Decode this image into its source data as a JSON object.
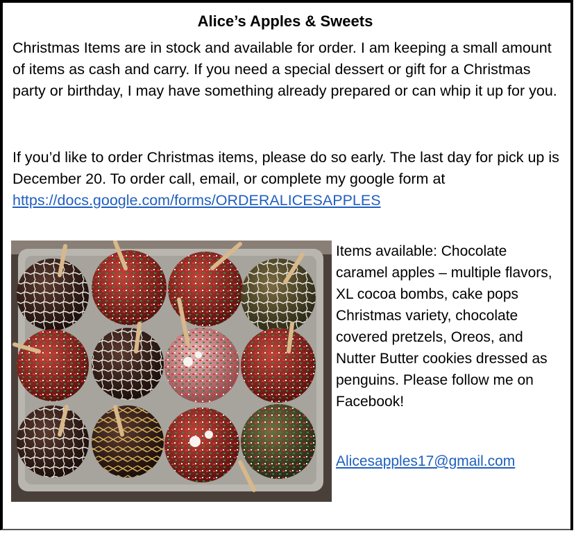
{
  "title": "Alice’s Apples & Sweets",
  "paragraph1": "Christmas Items are in stock and available for order.  I am keeping a small amount of items as cash and carry.  If you need a special dessert or gift for a Christmas party or birthday, I may have something already prepared or can whip it up for you.",
  "paragraph2_text": "If you’d like to order Christmas items, please do so early.   The last day for pick up is December 20. To order call, email, or complete my google form at ",
  "form_link": "https://docs.google.com/forms/ORDERALICESAPPLES",
  "side_text": "Items available:  Chocolate caramel apples – multiple flavors, XL cocoa bombs, cake pops Christmas variety, chocolate covered pretzels, Oreos, and Nutter Butter cookies dressed as penguins.  Please follow me on Facebook!",
  "email": "Alicesapples17@gmail.com",
  "colors": {
    "link": "#1f5fbf",
    "border": "#000000"
  }
}
